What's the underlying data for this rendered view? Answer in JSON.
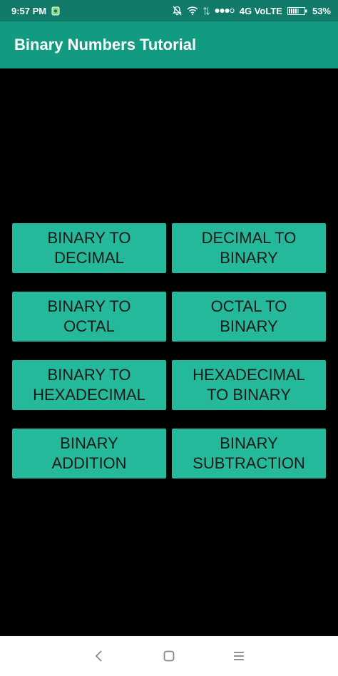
{
  "status_bar": {
    "time": "9:57 PM",
    "network": "4G VoLTE",
    "battery": "53%",
    "icons": [
      "app-notification-icon",
      "mute-icon",
      "wifi-icon",
      "data-icon",
      "signal-dots-icon",
      "battery-icon"
    ]
  },
  "app_bar": {
    "title": "Binary Numbers Tutorial"
  },
  "menu": {
    "buttons": [
      {
        "label": "BINARY TO\nDECIMAL"
      },
      {
        "label": "DECIMAL TO\nBINARY"
      },
      {
        "label": "BINARY TO\nOCTAL"
      },
      {
        "label": "OCTAL TO\nBINARY"
      },
      {
        "label": "BINARY TO\nHEXADECIMAL"
      },
      {
        "label": "HEXADECIMAL\nTO BINARY"
      },
      {
        "label": "BINARY\nADDITION"
      },
      {
        "label": "BINARY\nSUBTRACTION"
      }
    ]
  },
  "nav_bar": {
    "icons": [
      "back-icon",
      "home-icon",
      "menu-icon"
    ]
  },
  "colors": {
    "status_bar": "#117a69",
    "app_bar": "#139b82",
    "button": "#24b99a",
    "background": "#000000"
  }
}
